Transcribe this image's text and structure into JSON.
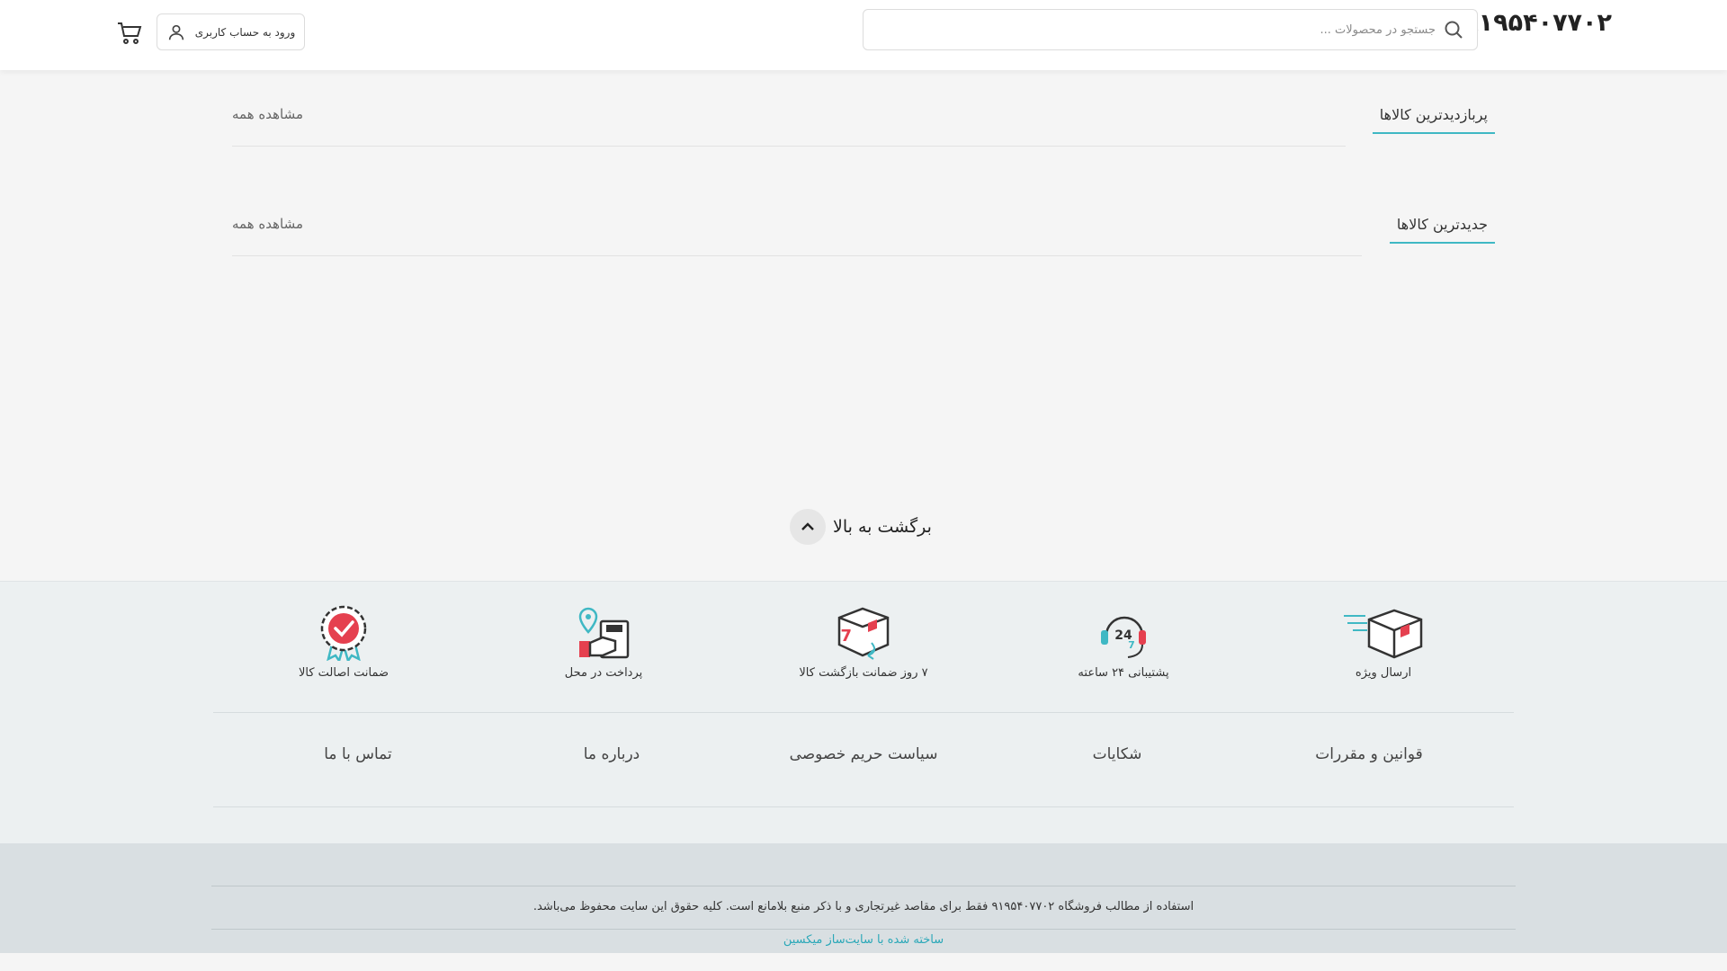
{
  "header": {
    "logo": "۹۱۹۵۴۰۷۷۰۲",
    "search_placeholder": "جستجو در محصولات ...",
    "login_label": "ورود به حساب کاربری"
  },
  "sections": [
    {
      "title": "پربازدیدترین کالاها",
      "view_all": "مشاهده همه"
    },
    {
      "title": "جدیدترین کالاها",
      "view_all": "مشاهده همه"
    }
  ],
  "back_to_top": "برگشت به بالا",
  "features": [
    {
      "label": "ارسال ویژه",
      "icon": "delivery-box-icon"
    },
    {
      "label": "پشتیبانی ۲۴ ساعته",
      "icon": "support-24-icon"
    },
    {
      "label": "۷ روز ضمانت بازگشت کالا",
      "icon": "return-7-days-icon"
    },
    {
      "label": "پرداخت در محل",
      "icon": "cash-on-delivery-icon"
    },
    {
      "label": "ضمانت اصالت کالا",
      "icon": "authenticity-badge-icon"
    }
  ],
  "footer_links": [
    "تماس با ما",
    "درباره ما",
    "سیاست حریم خصوصی",
    "شکایات",
    "قوانین و مقررات"
  ],
  "copyright": "استفاده از مطالب فروشگاه ۹۱۹۵۴۰۷۷۰۲ فقط برای مقاصد غیرتجاری و با ذکر منبع بلامانع است. کلیه حقوق این سایت محفوظ می‌باشد.",
  "builder_link": "ساخته شده با سایت‌ساز میکسین",
  "colors": {
    "accent": "#3fb8c4",
    "footer_bg": "#ecf0f1",
    "bottom_bg": "#d9dfe2",
    "icon_red": "#e5404f"
  }
}
